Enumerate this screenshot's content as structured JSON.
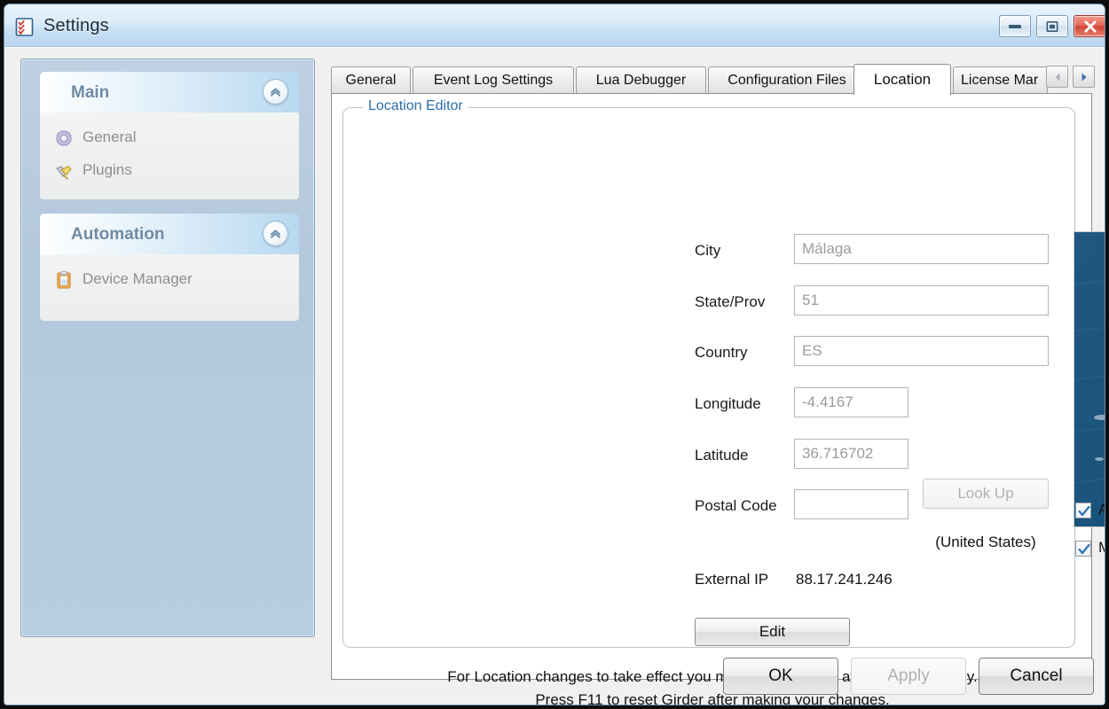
{
  "window": {
    "title": "Settings",
    "icon": "checklist-icon",
    "controls": {
      "minimize": "minimize-button",
      "maximize": "maximize-button",
      "close": "close-button"
    }
  },
  "sidebar": {
    "groups": [
      {
        "title": "Main",
        "collapse_icon": "chevron-up-icon",
        "items": [
          {
            "label": "General",
            "icon": "gear-icon"
          },
          {
            "label": "Plugins",
            "icon": "plug-icon"
          }
        ]
      },
      {
        "title": "Automation",
        "collapse_icon": "chevron-up-icon",
        "items": [
          {
            "label": "Device Manager",
            "icon": "clipboard-icon"
          }
        ]
      }
    ]
  },
  "tabs": {
    "items": [
      {
        "label": "General",
        "active": false
      },
      {
        "label": "Event Log Settings",
        "active": false
      },
      {
        "label": "Lua Debugger",
        "active": false
      },
      {
        "label": "Configuration Files",
        "active": false
      },
      {
        "label": "Location",
        "active": true
      },
      {
        "label": "License Mar",
        "active": false
      }
    ],
    "scroll_prev": "arrow-left-icon",
    "scroll_next": "arrow-right-icon"
  },
  "location_editor": {
    "legend": "Location Editor",
    "fields": [
      {
        "label": "City",
        "value": "Málaga",
        "placeholder": "Málaga"
      },
      {
        "label": "State/Prov",
        "value": "51",
        "placeholder": "51"
      },
      {
        "label": "Country",
        "value": "ES",
        "placeholder": "ES"
      },
      {
        "label": "Longitude",
        "value": "-4.4167",
        "placeholder": "-4.4167"
      },
      {
        "label": "Latitude",
        "value": "36.716702",
        "placeholder": "36.716702"
      },
      {
        "label": "Postal Code",
        "value": "",
        "placeholder": ""
      }
    ],
    "lookup_button": "Look Up",
    "country_note": "(United States)",
    "external_ip_label": "External IP",
    "external_ip_value": "88.17.241.246",
    "edit_button": "Edit",
    "checkboxes": [
      {
        "label": "Auto update location",
        "checked": true
      },
      {
        "label": "Monitor external IP address changes",
        "checked": true
      }
    ],
    "footnote_line1": "For Location changes to take effect you must Reset Girder after pressing Apply.",
    "footnote_line2": "Press F11 to reset Girder after making your changes.",
    "map_alt": "satellite-map-iberia-north-africa"
  },
  "dialog_buttons": {
    "ok": "OK",
    "apply": "Apply",
    "cancel": "Cancel"
  },
  "colors": {
    "accent_blue": "#2c6fa8",
    "titlebar_blue": "#b9d6ef",
    "sidebar_blue": "#b4c8dd",
    "close_red": "#cf4434",
    "disabled_gray": "#b0b0b0"
  }
}
